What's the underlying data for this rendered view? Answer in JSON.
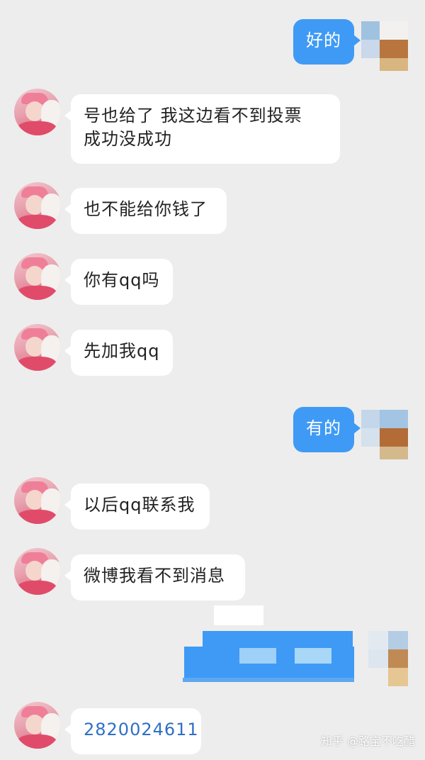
{
  "messages": [
    {
      "side": "right",
      "text": "好的"
    },
    {
      "side": "left",
      "text": "号也给了 我这边看不到投票成功没成功"
    },
    {
      "side": "left",
      "text": "也不能给你钱了"
    },
    {
      "side": "left",
      "text": "你有qq吗"
    },
    {
      "side": "left",
      "text": "先加我qq"
    },
    {
      "side": "right",
      "text": "有的"
    },
    {
      "side": "left",
      "text": "以后qq联系我"
    },
    {
      "side": "left",
      "text": "微博我看不到消息"
    },
    {
      "side": "right",
      "text": ""
    },
    {
      "side": "left",
      "text": "2820024611"
    }
  ],
  "bubble_line_1": "号也给了 我这边看不到投票",
  "bubble_line_2": "成功没成功",
  "watermark": "知乎 @路宝不吃醋",
  "colors": {
    "background": "#ededed",
    "outgoing_bubble": "#3f9af5",
    "incoming_bubble": "#ffffff",
    "number_text": "#2f6fc4"
  }
}
